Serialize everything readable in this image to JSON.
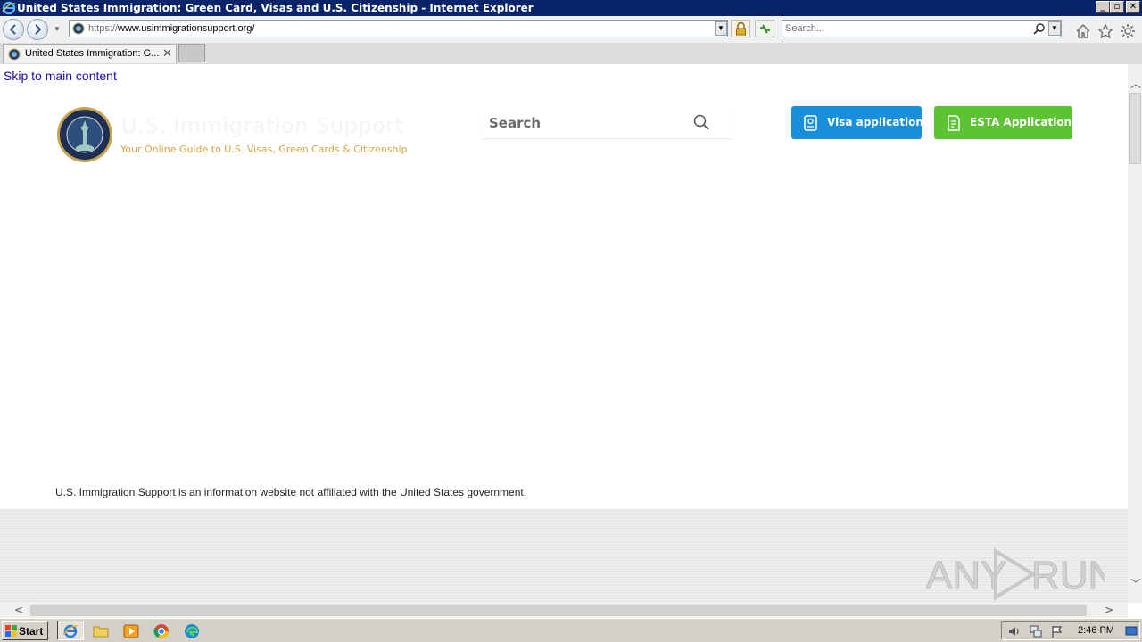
{
  "window": {
    "title": "United States Immigration: Green Card, Visas and U.S. Citizenship - Internet Explorer",
    "controls": {
      "minimize": "_",
      "maximize": "▫",
      "close": "✕"
    }
  },
  "addressbar": {
    "protocol": "https://",
    "host": "www.usimmigrationsupport.org/",
    "search_placeholder": "Search..."
  },
  "tabs": [
    {
      "label": "United States Immigration: G...",
      "active": true
    }
  ],
  "page": {
    "skip_link": "Skip to main content",
    "site_name": "U.S. Immigration Support",
    "tagline": "Your Online Guide to U.S. Visas, Green Cards & Citizenship",
    "search_placeholder": "Search",
    "buttons": {
      "visa": "Visa application",
      "esta": "ESTA Application"
    },
    "disclaimer": "U.S. Immigration Support is an information website not affiliated with the United States government.",
    "watermark": "ANY RUN"
  },
  "taskbar": {
    "start_label": "Start",
    "clock": "2:46 PM",
    "quick_launch": [
      "ie-icon",
      "folder-icon",
      "media-player-icon",
      "chrome-icon",
      "edge-icon"
    ]
  },
  "colors": {
    "visa_button": "#1a8fd9",
    "esta_button": "#5ec235",
    "tagline": "#d6a642",
    "titlebar": "#0a246a"
  }
}
